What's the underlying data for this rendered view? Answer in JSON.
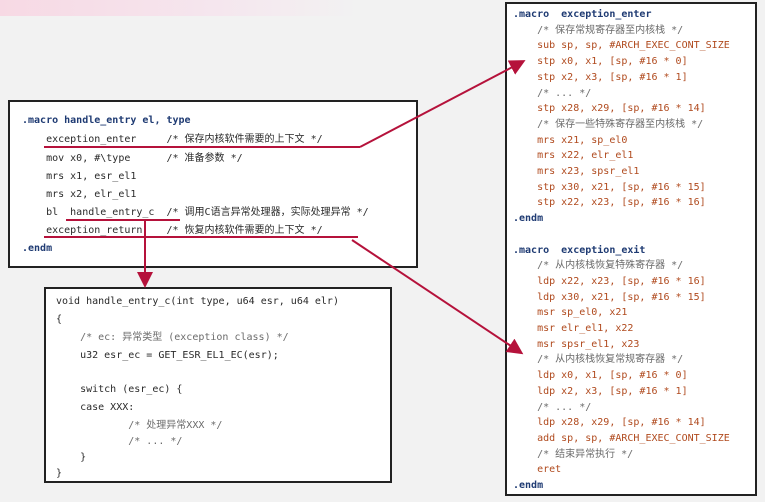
{
  "left_box": {
    "lines": [
      ".macro handle_entry el, type",
      "    exception_enter     /* 保存内核软件需要的上下文 */",
      "    mov x0, #\\type      /* 准备参数 */",
      "    mrs x1, esr_el1",
      "    mrs x2, elr_el1",
      "    bl  handle_entry_c  /* 调用C语言异常处理器，实际处理异常 */",
      "    exception_return    /* 恢复内核软件需要的上下文 */",
      ".endm"
    ]
  },
  "c_box": {
    "lines": [
      "void handle_entry_c(int type, u64 esr, u64 elr)",
      "{",
      "    /* ec: 异常类型 (exception class) */",
      "    u32 esr_ec = GET_ESR_EL1_EC(esr);",
      "",
      "    switch (esr_ec) {",
      "    case XXX:",
      "            /* 处理异常XXX */",
      "            /* ... */",
      "    }",
      "}"
    ]
  },
  "right_box": {
    "lines": [
      ".macro  exception_enter",
      "    /* 保存常规寄存器至内核栈 */",
      "    sub sp, sp, #ARCH_EXEC_CONT_SIZE",
      "    stp x0, x1, [sp, #16 * 0]",
      "    stp x2, x3, [sp, #16 * 1]",
      "    /* ... */",
      "    stp x28, x29, [sp, #16 * 14]",
      "    /* 保存一些特殊寄存器至内核栈 */",
      "    mrs x21, sp_el0",
      "    mrs x22, elr_el1",
      "    mrs x23, spsr_el1",
      "    stp x30, x21, [sp, #16 * 15]",
      "    stp x22, x23, [sp, #16 * 16]",
      ".endm",
      "",
      ".macro  exception_exit",
      "    /* 从内核栈恢复特殊寄存器 */",
      "    ldp x22, x23, [sp, #16 * 16]",
      "    ldp x30, x21, [sp, #16 * 15]",
      "    msr sp_el0, x21",
      "    msr elr_el1, x22",
      "    msr spsr_el1, x23",
      "    /* 从内核栈恢复常规寄存器 */",
      "    ldp x0, x1, [sp, #16 * 0]",
      "    ldp x2, x3, [sp, #16 * 1]",
      "    /* ... */",
      "    ldp x28, x29, [sp, #16 * 14]",
      "    add sp, sp, #ARCH_EXEC_CONT_SIZE",
      "    /* 结束异常执行 */",
      "    eret",
      ".endm"
    ]
  },
  "colors": {
    "arrow": "#b5123b",
    "comment": "#6b6b6b",
    "instruction": "#b04a1e",
    "keyword": "#1f3b73"
  }
}
